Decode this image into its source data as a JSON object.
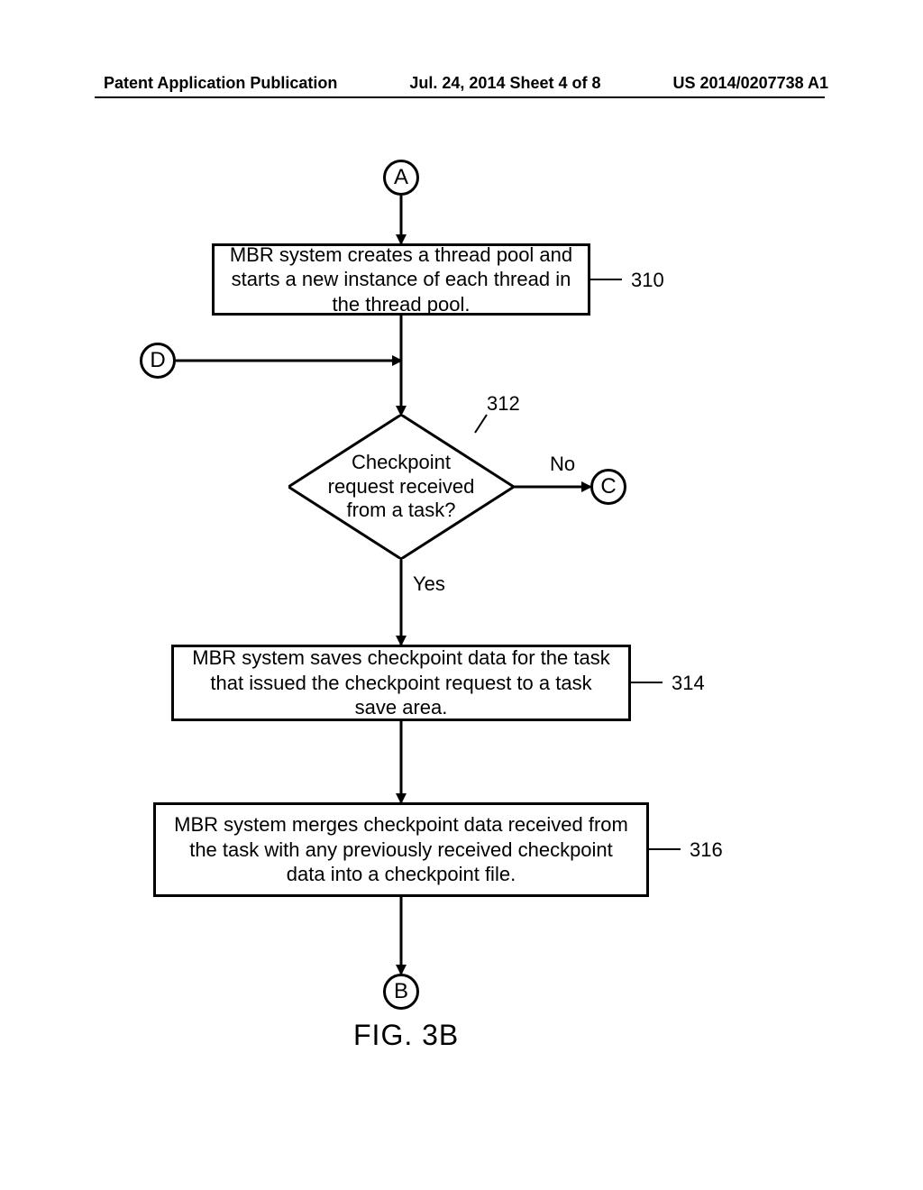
{
  "header": {
    "left": "Patent Application Publication",
    "center": "Jul. 24, 2014  Sheet 4 of 8",
    "right": "US 2014/0207738 A1"
  },
  "connectors": {
    "A": "A",
    "B": "B",
    "C": "C",
    "D": "D"
  },
  "steps": {
    "s310": "MBR system creates a thread pool and starts a new instance of each thread in the thread pool.",
    "s312": "Checkpoint request received from a task?",
    "s314": "MBR system saves checkpoint data for the task that issued the checkpoint request to a task save area.",
    "s316": "MBR system merges checkpoint data received from the task with any previously received checkpoint data into a checkpoint file."
  },
  "refs": {
    "r310": "310",
    "r312": "312",
    "r314": "314",
    "r316": "316"
  },
  "edges": {
    "yes": "Yes",
    "no": "No"
  },
  "figure": "FIG. 3B"
}
